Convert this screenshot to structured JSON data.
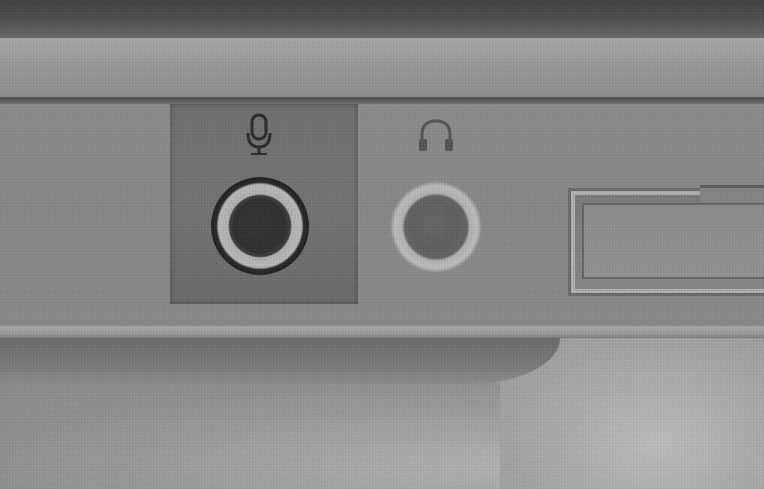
{
  "scene": {
    "subject": "laptop-side-audio-ports",
    "ports": [
      {
        "icon": "microphone-icon",
        "highlighted": true
      },
      {
        "icon": "headphone-icon",
        "highlighted": false
      }
    ],
    "colors": {
      "highlight_recess": "#6f6f6f",
      "panel": "#8a8a8a",
      "jack_ring": "#b5b5b5",
      "jack_hole": "#333333"
    }
  }
}
